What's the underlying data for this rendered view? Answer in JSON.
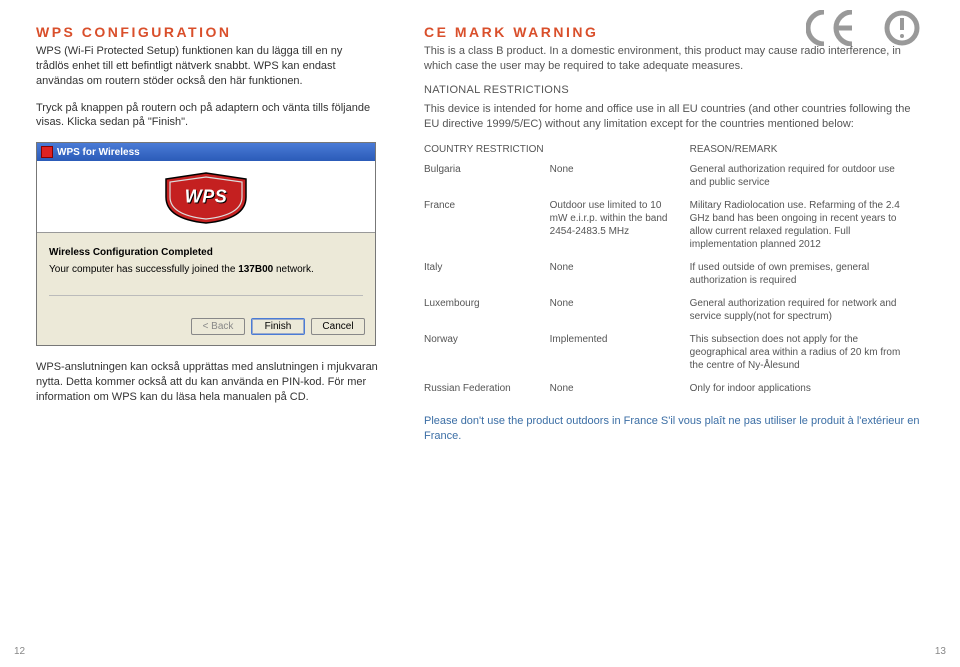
{
  "left": {
    "heading": "WPS CONFIGURATION",
    "p1": "WPS (Wi-Fi Protected Setup) funktionen kan du lägga till en ny trådlös enhet till ett befintligt nätverk snabbt. WPS kan endast användas om routern stöder också den här funktionen.",
    "p2": "Tryck på knappen på routern och på adaptern och vänta tills följande visas. Klicka sedan på \"Finish\".",
    "dialog": {
      "title": "WPS for Wireless",
      "shield": "WPS",
      "tab": "Wireless Configuration Completed",
      "line1": "Your computer has successfully joined the ",
      "network": "137B00",
      "line2": " network.",
      "back": "< Back",
      "finish": "Finish",
      "cancel": "Cancel"
    },
    "p3": "WPS-anslutningen kan också upprättas med anslutningen i mjukvaran nytta. Detta kommer också att du kan använda en PIN-kod. För mer information om WPS kan du läsa hela manualen på CD."
  },
  "right": {
    "heading": "CE MARK WARNING",
    "p1": "This is a class B product. In a domestic environment, this product may cause radio interference, in which case the user may be required to take adequate measures.",
    "nat_heading": "NATIONAL RESTRICTIONS",
    "p2": "This device is intended for home and office use in all EU countries (and other countries following the EU directive 1999/5/EC) without any limitation except for the countries mentioned below:",
    "th_country": "COUNTRY",
    "th_restriction": "RESTRICTION",
    "th_reason": "REASON/REMARK",
    "rows": [
      {
        "country": "Bulgaria",
        "restriction": "None",
        "reason": "General authorization required for outdoor use and public service"
      },
      {
        "country": "France",
        "restriction": "Outdoor use limited to 10 mW e.i.r.p. within the band 2454-2483.5 MHz",
        "reason": "Military Radiolocation use. Refarming of the 2.4 GHz band has been ongoing in recent years to allow current relaxed regulation. Full implementation planned 2012"
      },
      {
        "country": "Italy",
        "restriction": "None",
        "reason": "If used outside of own premises, general authorization is required"
      },
      {
        "country": "Luxembourg",
        "restriction": "None",
        "reason": "General authorization required for network and service supply(not for spectrum)"
      },
      {
        "country": "Norway",
        "restriction": "Implemented",
        "reason": "This subsection does not apply for the geographical area within a radius of 20 km from the centre of Ny-Ålesund"
      },
      {
        "country": "Russian Federation",
        "restriction": "None",
        "reason": "Only for indoor applications"
      }
    ],
    "footer": "Please don't use the product outdoors in France S'il vous plaît ne pas utiliser le produit à l'extérieur en France."
  },
  "pages": {
    "left": "12",
    "right": "13"
  }
}
